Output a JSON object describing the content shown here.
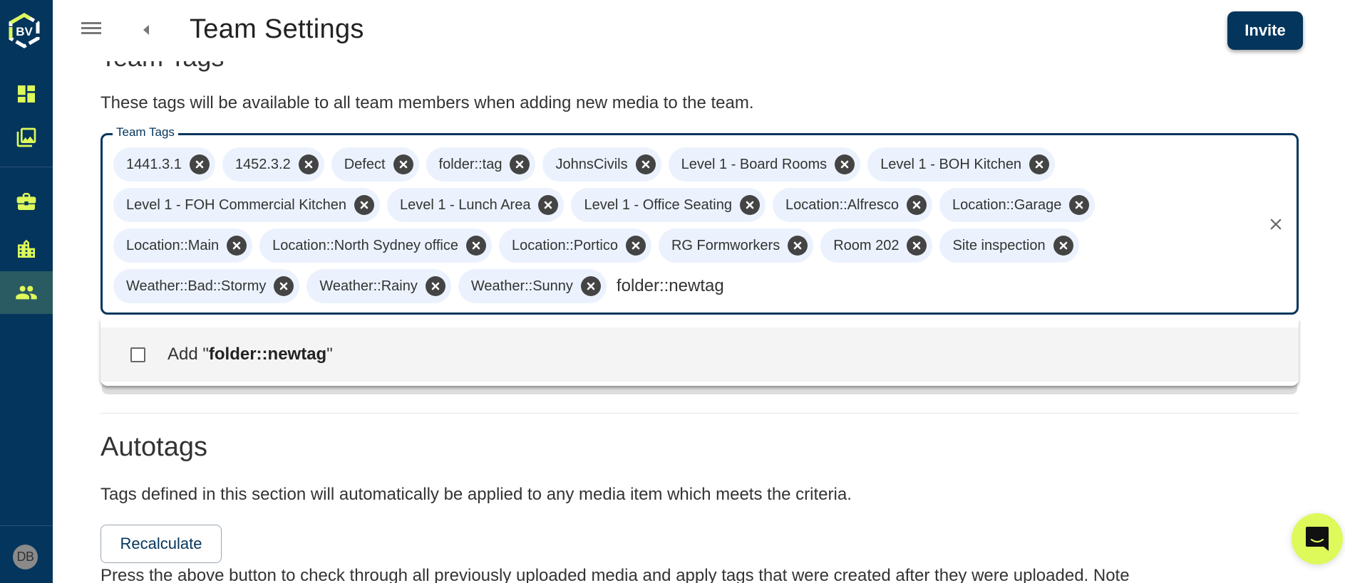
{
  "app": {
    "logo_text": "BV",
    "user_initials": "DB",
    "colors": {
      "sidebar_bg": "#04355c",
      "accent": "#ddf95a",
      "active_nav": "#2a5a62",
      "chip_bg": "#ebf2fd",
      "primary": "#04355c"
    }
  },
  "sidebar": {
    "items": [
      {
        "name": "dashboard",
        "icon": "dashboard-icon",
        "active": false
      },
      {
        "name": "media",
        "icon": "photo-library-icon",
        "active": false
      },
      {
        "name": "projects",
        "icon": "briefcase-icon",
        "active": false
      },
      {
        "name": "organisations",
        "icon": "building-icon",
        "active": false
      },
      {
        "name": "teams",
        "icon": "people-icon",
        "active": true
      }
    ]
  },
  "header": {
    "title": "Team Settings",
    "invite_label": "Invite"
  },
  "team_tags": {
    "section_title": "Team Tags",
    "description": "These tags will be available to all team members when adding new media to the team.",
    "field_label": "Team Tags",
    "tags": [
      "1441.3.1",
      "1452.3.2",
      "Defect",
      "folder::tag",
      "JohnsCivils",
      "Level 1 - Board Rooms",
      "Level 1 - BOH Kitchen",
      "Level 1 - FOH Commercial Kitchen",
      "Level 1 - Lunch Area",
      "Level 1 - Office Seating",
      "Location::Alfresco",
      "Location::Garage",
      "Location::Main",
      "Location::North Sydney office",
      "Location::Portico",
      "RG Formworkers",
      "Room 202",
      "Site inspection",
      "Weather::Bad::Stormy",
      "Weather::Rainy",
      "Weather::Sunny"
    ],
    "input_value": "folder::newtag",
    "dropdown": {
      "add_prefix": "Add \"",
      "add_value": "folder::newtag",
      "add_suffix": "\"",
      "checked": false
    }
  },
  "autotags": {
    "title": "Autotags",
    "description": "Tags defined in this section will automatically be applied to any media item which meets the criteria.",
    "recalculate_label": "Recalculate",
    "note": "Press the above button to check through all previously uploaded media and apply tags that were created after they were uploaded. Note"
  }
}
